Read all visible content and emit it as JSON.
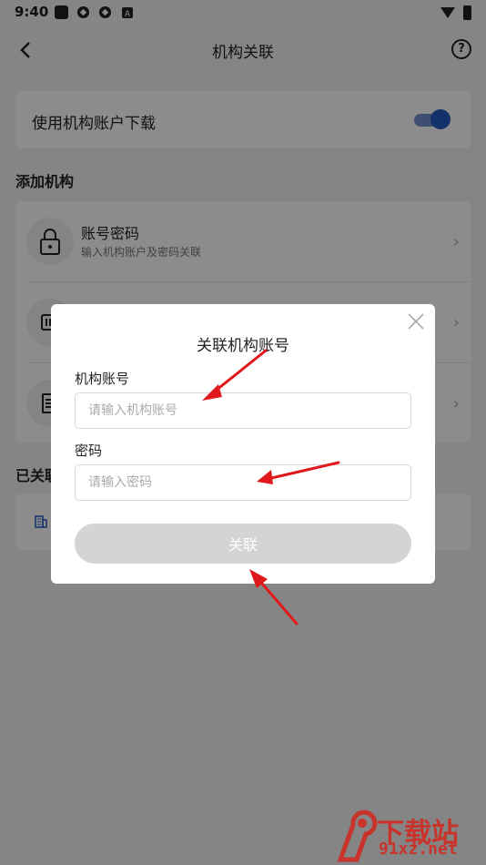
{
  "status_bar": {
    "time": "9:40"
  },
  "header": {
    "title": "机构关联",
    "help": "?"
  },
  "settings": {
    "use_org_account_label": "使用机构账户下载",
    "toggle_on": true
  },
  "add_org": {
    "section_title": "添加机构",
    "items": [
      {
        "title": "账号密码",
        "subtitle": "输入机构账户及密码关联"
      },
      {
        "title": "",
        "subtitle": ""
      },
      {
        "title": "",
        "subtitle": ""
      }
    ]
  },
  "linked": {
    "section_title": "已关联"
  },
  "modal": {
    "title": "关联机构账号",
    "account_label": "机构账号",
    "account_placeholder": "请输入机构账号",
    "password_label": "密码",
    "password_placeholder": "请输入密码",
    "submit_label": "关联"
  },
  "watermark": {
    "big_text": "下载站",
    "small_text": "91xz.net"
  },
  "colors": {
    "accent": "#2359c4",
    "arrow": "#e0191c",
    "watermark": "#c8342b"
  }
}
